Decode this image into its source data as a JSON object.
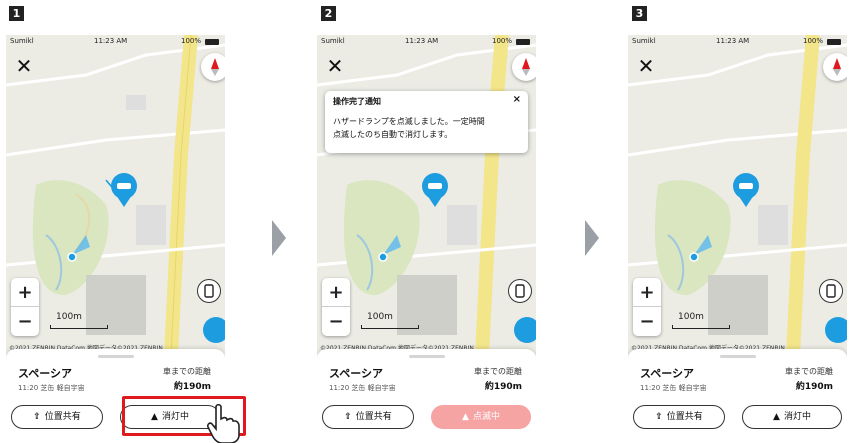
{
  "steps": [
    "1",
    "2",
    "3"
  ],
  "status_bar": {
    "carrier": "Sumikl",
    "time": "11:23 AM",
    "battery": "100%"
  },
  "map": {
    "scale_label": "100m",
    "copyright": "©2021 ZENRIN DataCom  地図データ©2021 ZENRIN"
  },
  "vehicle": {
    "name": "スペーシア",
    "sub": "11:20 芝缶 軽自宇宙",
    "distance_label": "車までの距離",
    "distance_value": "約190m"
  },
  "buttons": {
    "share_label": "位置共有",
    "light_label_1": "消灯中",
    "light_label_2": "点滅中",
    "light_label_3": "消灯中"
  },
  "notice": {
    "title": "操作完了通知",
    "body_line1": "ハザードランプを点滅しました。一定時間",
    "body_line2": "点滅したのち自動で消灯します。",
    "close": "×"
  },
  "icons": {
    "close": "close-icon",
    "compass": "compass-icon",
    "share": "share-icon",
    "hazard": "hazard-icon",
    "phone": "phone-icon",
    "hand": "pointing-hand-icon",
    "arrow": "chevron-right-icon"
  },
  "colors": {
    "accent_blue": "#1e9ce0",
    "highlight_red": "#e0191f",
    "blink_pink": "#f6a3a3",
    "route_yellow": "#f3e58a"
  }
}
